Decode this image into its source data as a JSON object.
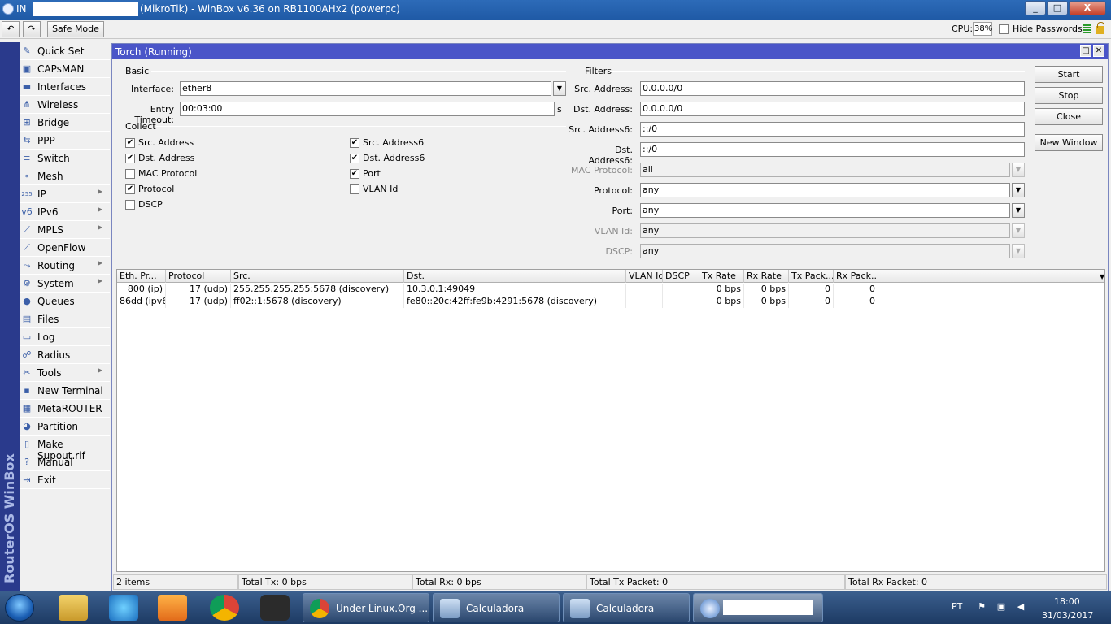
{
  "window": {
    "title_prefix": "IN",
    "title": "(MikroTik) - WinBox v6.36 on RB1100AHx2 (powerpc)",
    "minimize": "_",
    "maximize": "□",
    "close": "X"
  },
  "toolbar": {
    "undo_label": "↶",
    "redo_label": "↷",
    "safe_mode_label": "Safe Mode",
    "cpu_label": "CPU:",
    "cpu_value": "38%",
    "hide_passwords_label": "Hide Passwords"
  },
  "brand": "RouterOS WinBox",
  "sidebar": {
    "items": [
      {
        "label": "Quick Set",
        "icon": "wand-icon",
        "glyph": "✎",
        "arrow": false
      },
      {
        "label": "CAPsMAN",
        "icon": "capsman-icon",
        "glyph": "▣",
        "arrow": false
      },
      {
        "label": "Interfaces",
        "icon": "interfaces-icon",
        "glyph": "▬",
        "arrow": false
      },
      {
        "label": "Wireless",
        "icon": "wireless-icon",
        "glyph": "⋔",
        "arrow": false
      },
      {
        "label": "Bridge",
        "icon": "bridge-icon",
        "glyph": "⊞",
        "arrow": false
      },
      {
        "label": "PPP",
        "icon": "ppp-icon",
        "glyph": "⇆",
        "arrow": false
      },
      {
        "label": "Switch",
        "icon": "switch-icon",
        "glyph": "≡",
        "arrow": false
      },
      {
        "label": "Mesh",
        "icon": "mesh-icon",
        "glyph": "∘",
        "arrow": false
      },
      {
        "label": "IP",
        "icon": "ip-icon",
        "glyph": "255",
        "arrow": true
      },
      {
        "label": "IPv6",
        "icon": "ipv6-icon",
        "glyph": "v6",
        "arrow": true
      },
      {
        "label": "MPLS",
        "icon": "mpls-icon",
        "glyph": "⟋",
        "arrow": true
      },
      {
        "label": "OpenFlow",
        "icon": "openflow-icon",
        "glyph": "⟋",
        "arrow": false
      },
      {
        "label": "Routing",
        "icon": "routing-icon",
        "glyph": "⤳",
        "arrow": true
      },
      {
        "label": "System",
        "icon": "gear-icon",
        "glyph": "⚙",
        "arrow": true
      },
      {
        "label": "Queues",
        "icon": "queues-icon",
        "glyph": "●",
        "arrow": false
      },
      {
        "label": "Files",
        "icon": "folder-icon",
        "glyph": "▤",
        "arrow": false
      },
      {
        "label": "Log",
        "icon": "log-icon",
        "glyph": "▭",
        "arrow": false
      },
      {
        "label": "Radius",
        "icon": "radius-icon",
        "glyph": "☍",
        "arrow": false
      },
      {
        "label": "Tools",
        "icon": "tools-icon",
        "glyph": "✂",
        "arrow": true
      },
      {
        "label": "New Terminal",
        "icon": "terminal-icon",
        "glyph": "▪",
        "arrow": false
      },
      {
        "label": "MetaROUTER",
        "icon": "metarouter-icon",
        "glyph": "▦",
        "arrow": false
      },
      {
        "label": "Partition",
        "icon": "partition-icon",
        "glyph": "◕",
        "arrow": false
      },
      {
        "label": "Make Supout.rif",
        "icon": "supout-icon",
        "glyph": "▯",
        "arrow": false
      },
      {
        "label": "Manual",
        "icon": "help-icon",
        "glyph": "?",
        "arrow": false
      },
      {
        "label": "Exit",
        "icon": "exit-icon",
        "glyph": "⇥",
        "arrow": false
      }
    ]
  },
  "torch": {
    "title": "Torch (Running)",
    "basic": {
      "group_label": "Basic",
      "interface_label": "Interface:",
      "interface_value": "ether8",
      "entry_timeout_label": "Entry Timeout:",
      "entry_timeout_value": "00:03:00",
      "entry_timeout_unit": "s"
    },
    "collect": {
      "group_label": "Collect",
      "items": [
        {
          "label": "Src. Address",
          "checked": "✔"
        },
        {
          "label": "Dst. Address",
          "checked": "✔"
        },
        {
          "label": "MAC Protocol",
          "checked": ""
        },
        {
          "label": "Protocol",
          "checked": "✔"
        },
        {
          "label": "DSCP",
          "checked": ""
        },
        {
          "label": "Src. Address6",
          "checked": "✔"
        },
        {
          "label": "Dst. Address6",
          "checked": "✔"
        },
        {
          "label": "Port",
          "checked": "✔"
        },
        {
          "label": "VLAN Id",
          "checked": ""
        }
      ]
    },
    "filters": {
      "group_label": "Filters",
      "src_address_label": "Src. Address:",
      "src_address_value": "0.0.0.0/0",
      "dst_address_label": "Dst. Address:",
      "dst_address_value": "0.0.0.0/0",
      "src_address6_label": "Src. Address6:",
      "src_address6_value": "::/0",
      "dst_address6_label": "Dst. Address6:",
      "dst_address6_value": "::/0",
      "mac_protocol_label": "MAC Protocol:",
      "mac_protocol_value": "all",
      "protocol_label": "Protocol:",
      "protocol_value": "any",
      "port_label": "Port:",
      "port_value": "any",
      "vlan_id_label": "VLAN Id:",
      "vlan_id_value": "any",
      "dscp_label": "DSCP:",
      "dscp_value": "any"
    },
    "buttons": {
      "start": "Start",
      "stop": "Stop",
      "close": "Close",
      "new_window": "New Window"
    },
    "table": {
      "columns": [
        "Eth. Pr...",
        "Protocol",
        "Src.",
        "Dst.",
        "VLAN Id",
        "DSCP",
        "Tx Rate",
        "Rx Rate",
        "Tx Pack...",
        "Rx Pack..."
      ],
      "rows": [
        [
          "800 (ip)",
          "17 (udp)",
          "255.255.255.255:5678 (discovery)",
          "10.3.0.1:49049",
          "",
          "",
          "0 bps",
          "0 bps",
          "0",
          "0"
        ],
        [
          "86dd (ipv6)",
          "17 (udp)",
          "ff02::1:5678 (discovery)",
          "fe80::20c:42ff:fe9b:4291:5678 (discovery)",
          "",
          "",
          "0 bps",
          "0 bps",
          "0",
          "0"
        ]
      ]
    },
    "status": {
      "items": "2 items",
      "total_tx": "Total Tx: 0 bps",
      "total_rx": "Total Rx: 0 bps",
      "total_tx_packet": "Total Tx Packet: 0",
      "total_rx_packet": "Total Rx Packet: 0"
    }
  },
  "taskbar": {
    "tasks": [
      {
        "label": "Under-Linux.Org ...",
        "icon": "chrome-icon"
      },
      {
        "label": "Calculadora",
        "icon": "calculator-icon"
      },
      {
        "label": "Calculadora",
        "icon": "calculator-icon"
      }
    ],
    "language": "PT",
    "time": "18:00",
    "date": "31/03/2017"
  },
  "colors": {
    "torch_titlebar": "#4a55c8",
    "brand_strip": "#2a3a8c",
    "taskbar": "#1d3a63"
  }
}
